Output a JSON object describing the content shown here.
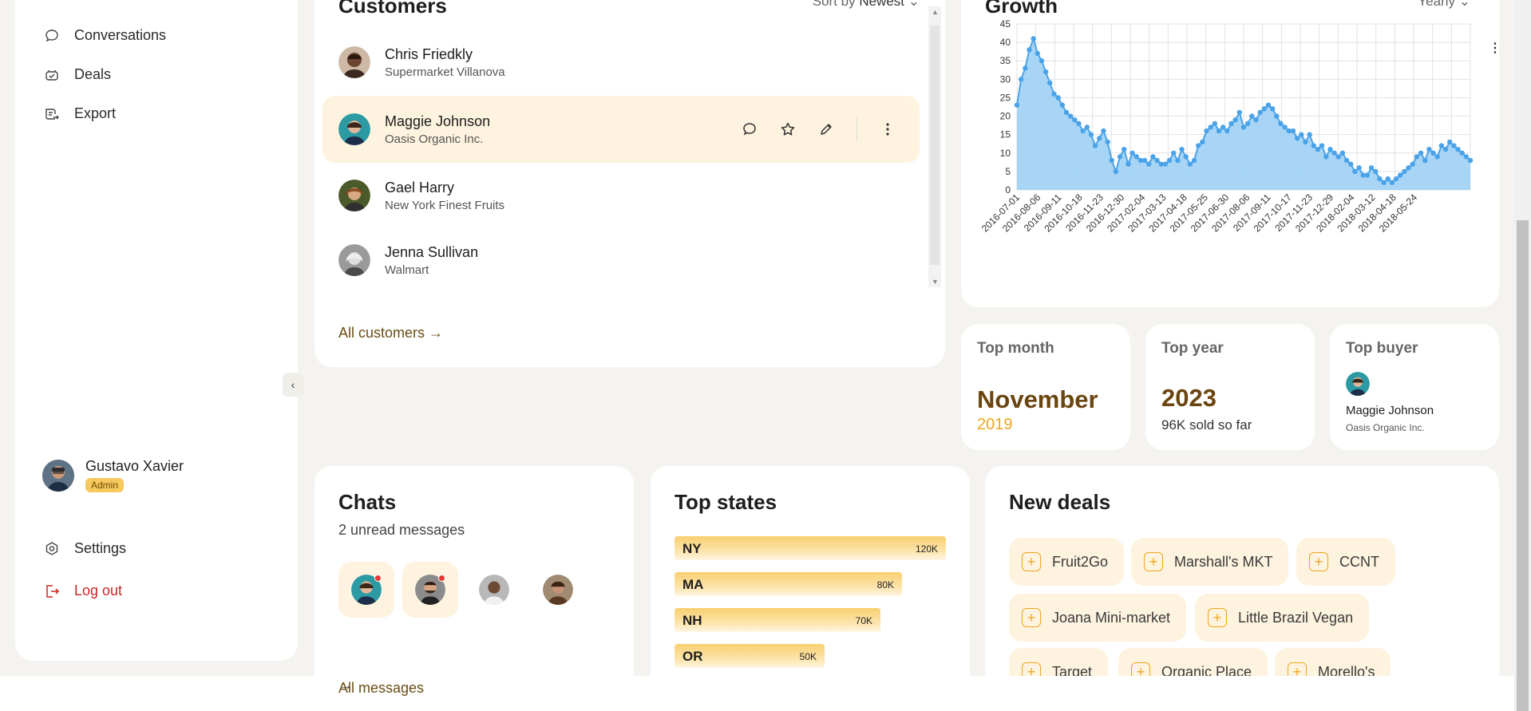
{
  "sidebar": {
    "nav": [
      {
        "label": "Conversations",
        "icon": "chat-bubble-icon"
      },
      {
        "label": "Deals",
        "icon": "handshake-icon"
      },
      {
        "label": "Export",
        "icon": "export-icon"
      }
    ],
    "user": {
      "name": "Gustavo Xavier",
      "role": "Admin"
    },
    "settings_label": "Settings",
    "logout_label": "Log out"
  },
  "customers": {
    "title": "Customers",
    "sort_prefix": "Sort by",
    "sort_value": "Newest",
    "rows": [
      {
        "name": "Chris Friedkly",
        "company": "Supermarket Villanova"
      },
      {
        "name": "Maggie Johnson",
        "company": "Oasis Organic Inc."
      },
      {
        "name": "Gael Harry",
        "company": "New York Finest Fruits"
      },
      {
        "name": "Jenna Sullivan",
        "company": "Walmart"
      }
    ],
    "all_link": "All customers →"
  },
  "growth": {
    "title": "Growth",
    "period": "Yearly"
  },
  "stats": {
    "top_month": {
      "label": "Top month",
      "value": "November",
      "sub": "2019"
    },
    "top_year": {
      "label": "Top year",
      "value": "2023",
      "sub": "96K sold so far"
    },
    "top_buyer": {
      "label": "Top buyer",
      "name": "Maggie Johnson",
      "company": "Oasis Organic Inc."
    }
  },
  "chats": {
    "title": "Chats",
    "subtitle": "2 unread messages",
    "link": "All messages"
  },
  "top_states": {
    "title": "Top states",
    "rows": [
      {
        "state": "NY",
        "value": "120K"
      },
      {
        "state": "MA",
        "value": "80K"
      },
      {
        "state": "NH",
        "value": "70K"
      },
      {
        "state": "OR",
        "value": "50K"
      }
    ]
  },
  "new_deals": {
    "title": "New deals",
    "items": [
      "Fruit2Go",
      "Marshall's MKT",
      "CCNT",
      "Joana Mini-market",
      "Little Brazil Vegan",
      "Target",
      "Organic Place",
      "Morello's"
    ]
  },
  "chart_data": {
    "type": "area",
    "ylim": [
      0,
      45
    ],
    "yticks": [
      0,
      5,
      10,
      15,
      20,
      25,
      30,
      35,
      40,
      45
    ],
    "xticks": [
      "2016-07-01",
      "2016-08-06",
      "2016-09-11",
      "2016-10-18",
      "2016-11-23",
      "2016-12-30",
      "2017-02-04",
      "2017-03-13",
      "2017-04-18",
      "2017-05-25",
      "2017-06-30",
      "2017-08-06",
      "2017-09-11",
      "2017-10-17",
      "2017-11-23",
      "2017-12-29",
      "2018-02-04",
      "2018-03-12",
      "2018-04-18",
      "2018-05-24"
    ],
    "x_start": "2016-07-01",
    "x_end": "2018-06-28",
    "series": [
      {
        "color": "#4aa3e8",
        "values": [
          23,
          30,
          33,
          38,
          41,
          37,
          35,
          32,
          29,
          26,
          25,
          23,
          21,
          20,
          19,
          18,
          16,
          17,
          15,
          12,
          14,
          16,
          13,
          8,
          5,
          9,
          11,
          7,
          10,
          9,
          8,
          8,
          7,
          9,
          8,
          7,
          7,
          8,
          10,
          8,
          11,
          9,
          7,
          8,
          12,
          13,
          16,
          17,
          18,
          16,
          17,
          16,
          18,
          19,
          21,
          17,
          18,
          20,
          19,
          21,
          22,
          23,
          22,
          20,
          18,
          17,
          16,
          16,
          14,
          15,
          13,
          15,
          12,
          11,
          12,
          9,
          11,
          10,
          9,
          10,
          8,
          7,
          5,
          6,
          4,
          4,
          6,
          5,
          3,
          2,
          3,
          2,
          3,
          4,
          5,
          6,
          7,
          9,
          10,
          8,
          11,
          10,
          9,
          12,
          11,
          13,
          12,
          11,
          10,
          9,
          8
        ]
      }
    ]
  }
}
